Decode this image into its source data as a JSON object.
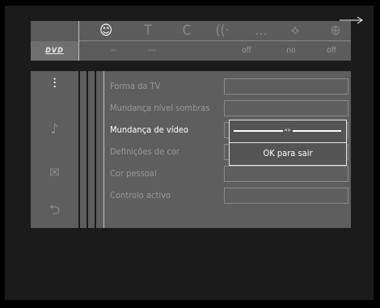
{
  "top_icons": [
    {
      "name": "subtitles-person-icon",
      "glyph": "☺",
      "active": true
    },
    {
      "name": "title-icon",
      "glyph": "T",
      "active": false
    },
    {
      "name": "chapter-icon",
      "glyph": "C",
      "active": false
    },
    {
      "name": "audio-icon",
      "glyph": "((·",
      "active": false
    },
    {
      "name": "subtitle-bubble-icon",
      "glyph": "…",
      "active": false
    },
    {
      "name": "angle-icon",
      "glyph": "⟡",
      "active": false
    },
    {
      "name": "zoom-icon",
      "glyph": "⊕",
      "active": false
    }
  ],
  "top_values": [
    "--",
    "---",
    "off",
    "no",
    "off"
  ],
  "disc_label": "DVD",
  "sidebar_icons": [
    {
      "name": "video-picture-icon",
      "glyph": "⫶",
      "active": true
    },
    {
      "name": "music-note-icon",
      "glyph": "♪",
      "active": false
    },
    {
      "name": "speech-bubble-icon",
      "glyph": "✉",
      "active": false
    },
    {
      "name": "plug-connector-icon",
      "glyph": "⮌",
      "active": false
    }
  ],
  "menu": [
    {
      "label": "Forma da TV",
      "selected": false
    },
    {
      "label": "Mundança nível sombras",
      "selected": false
    },
    {
      "label": "Mundança de vídeo",
      "selected": true
    },
    {
      "label": "Definições de cor",
      "selected": false
    },
    {
      "label": "Cor pessoal",
      "selected": false
    },
    {
      "label": "Controlo activo",
      "selected": false
    }
  ],
  "popup": {
    "knob_glyph": "«»",
    "message": "OK para sair",
    "slider_level": 0.5
  }
}
